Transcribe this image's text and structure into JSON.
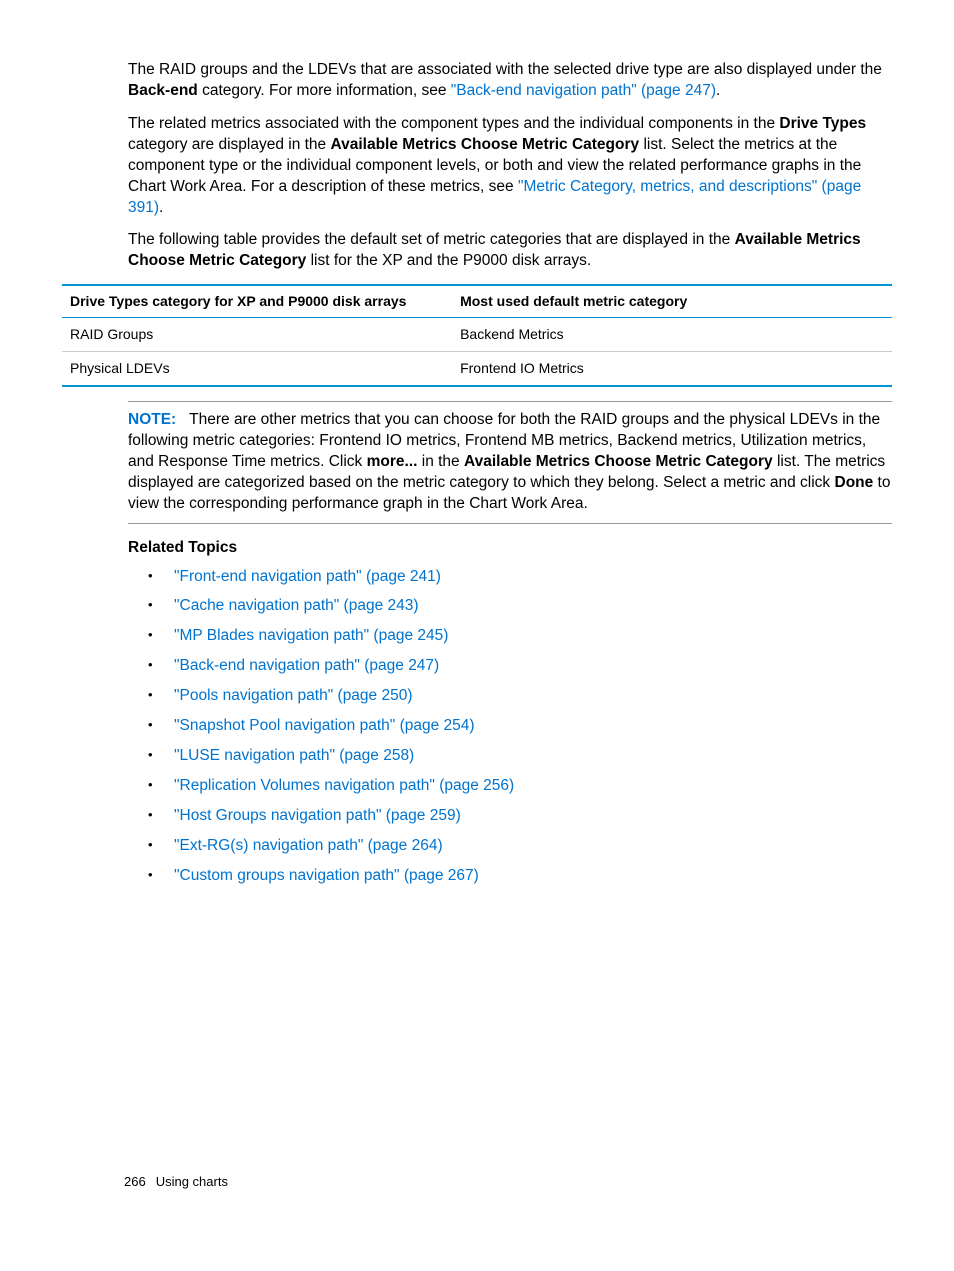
{
  "para1": {
    "t1": "The RAID groups and the LDEVs that are associated with the selected drive type are also displayed under the ",
    "b1": "Back-end",
    "t2": " category. For more information, see ",
    "link": "\"Back-end navigation path\" (page 247)",
    "t3": "."
  },
  "para2": {
    "t1": "The related metrics associated with the component types and the individual components in the ",
    "b1": "Drive Types",
    "t2": " category are displayed in the ",
    "b2": "Available Metrics Choose Metric Category",
    "t3": " list. Select the metrics at the component type or the individual component levels, or both and view the related performance graphs in the Chart Work Area. For a description of these metrics, see ",
    "link": "\"Metric Category, metrics, and descriptions\" (page 391)",
    "t4": "."
  },
  "para3": {
    "t1": "The following table provides the default set of metric categories that are displayed in the ",
    "b1": "Available Metrics Choose Metric Category",
    "t2": " list for the XP and the P9000 disk arrays."
  },
  "table": {
    "h1": "Drive Types category for XP and P9000 disk arrays",
    "h2": "Most used default metric category",
    "r1c1": "RAID Groups",
    "r1c2": "Backend Metrics",
    "r2c1": "Physical LDEVs",
    "r2c2": "Frontend IO Metrics"
  },
  "note": {
    "label": "NOTE:",
    "t1": "There are other metrics that you can choose for both the RAID groups and the physical LDEVs in the following metric categories: Frontend IO metrics, Frontend MB metrics, Backend metrics, Utilization metrics, and Response Time metrics. Click ",
    "b1": "more...",
    "t2": " in the ",
    "b2": "Available Metrics Choose Metric Category",
    "t3": " list. The metrics displayed are categorized based on the metric category to which they belong. Select a metric and click ",
    "b3": "Done",
    "t4": " to view the corresponding performance graph in the Chart Work Area."
  },
  "related": {
    "heading": "Related Topics",
    "items": [
      "\"Front-end navigation path\" (page 241)",
      "\"Cache navigation path\" (page 243)",
      "\"MP Blades navigation path\" (page 245)",
      "\"Back-end navigation path\" (page 247)",
      "\"Pools navigation path\" (page 250)",
      "\"Snapshot Pool navigation path\" (page 254)",
      "\"LUSE navigation path\" (page 258)",
      "\"Replication Volumes navigation path\" (page 256)",
      "\"Host Groups navigation path\" (page 259)",
      "\"Ext-RG(s) navigation path\" (page 264)",
      "\"Custom groups navigation path\" (page 267)"
    ]
  },
  "footer": {
    "page": "266",
    "section": "Using charts"
  }
}
